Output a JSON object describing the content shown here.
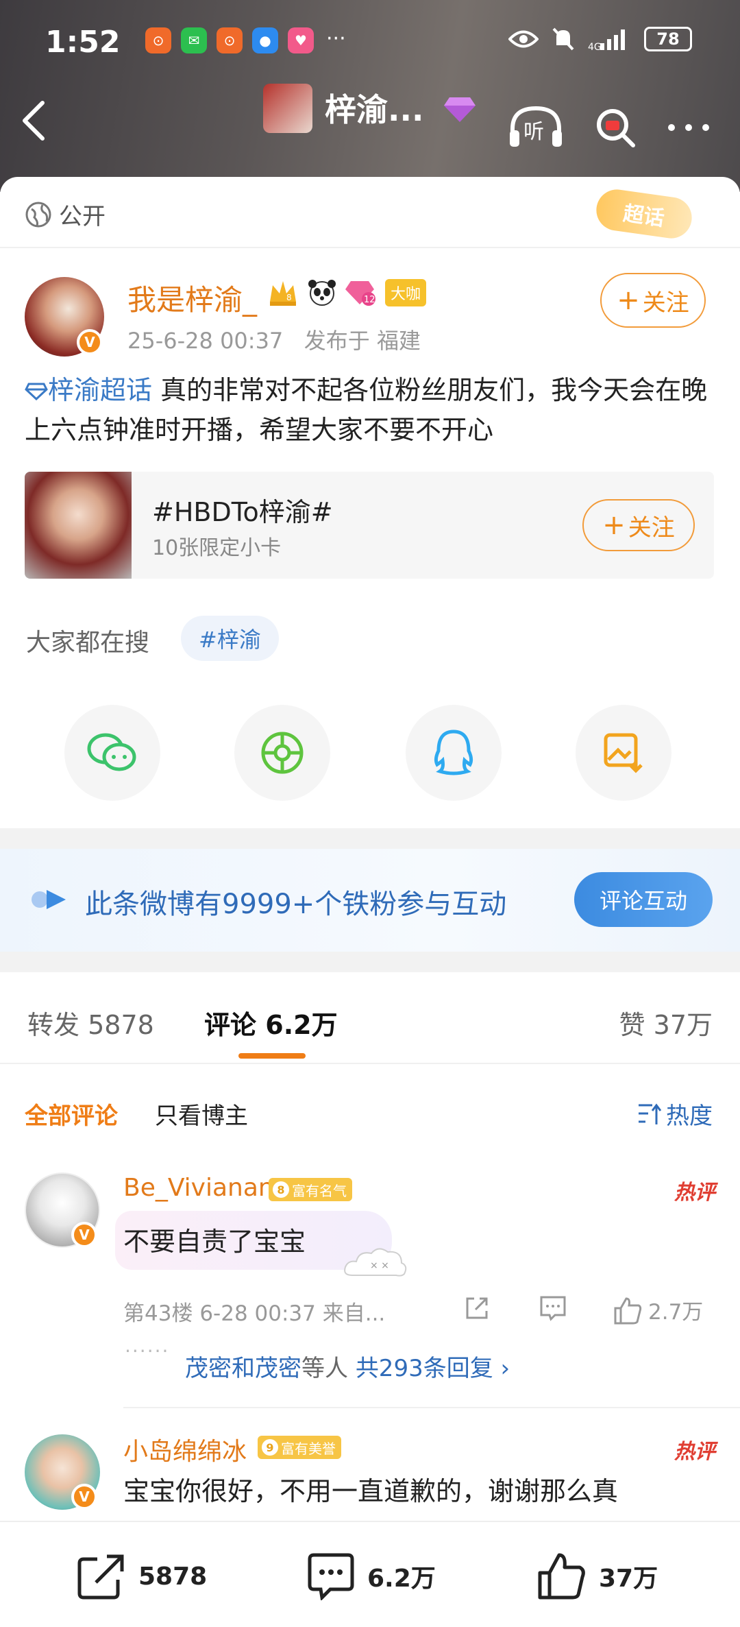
{
  "status_bar": {
    "time": "1:52",
    "battery": "78",
    "more": "···",
    "signal": "4G"
  },
  "nav": {
    "title": "梓渝...",
    "back": "back"
  },
  "post": {
    "visibility": "公开",
    "chaohua_badge": "超话",
    "author": "我是梓渝_",
    "author_tag": "大咖",
    "level_badge": "12",
    "time": "25-6-28 00:37",
    "location": "发布于 福建",
    "follow": "关注",
    "topic_link": "梓渝超话",
    "text": " 真的非常对不起各位粉丝朋友们，我今天会在晚上六点钟准时开播，希望大家不要不开心",
    "topic_card": {
      "title": "#HBDTo梓渝#",
      "subtitle": "10张限定小卡",
      "follow": "关注"
    },
    "search_label": "大家都在搜",
    "search_tag": "#梓渝"
  },
  "share_icons": [
    "wechat-icon",
    "moments-icon",
    "qq-icon",
    "save-image-icon"
  ],
  "fans_banner": {
    "text": "此条微博有9999+个铁粉参与互动",
    "button": "评论互动"
  },
  "tabs": [
    {
      "label": "转发",
      "count": "5878"
    },
    {
      "label": "评论",
      "count": "6.2万"
    },
    {
      "label": "赞",
      "count": "37万"
    }
  ],
  "filters": {
    "all": "全部评论",
    "author_only": "只看博主",
    "sort": "热度"
  },
  "comments": [
    {
      "name": "Be_Vivianan",
      "level": "8",
      "level_text": "富有名气",
      "hot": "热评",
      "text": "不要自责了宝宝",
      "floor": "第43楼",
      "time": "6-28 00:37",
      "source": "来自...",
      "likes": "2.7万",
      "reply_names": "茂密和茂密",
      "reply_suffix": "等人",
      "reply_count": "共293条回复"
    },
    {
      "name": "小岛绵绵冰",
      "level": "9",
      "level_text": "富有美誉",
      "hot": "热评",
      "text": "宝宝你很好，不用一直道歉的，谢谢那么真"
    }
  ],
  "bottom_bar": {
    "repost": "5878",
    "comment": "6.2万",
    "like": "37万"
  },
  "colors": {
    "orange": "#ee8a1a",
    "blue": "#2f6bb8",
    "hot_red": "#e03e32"
  }
}
